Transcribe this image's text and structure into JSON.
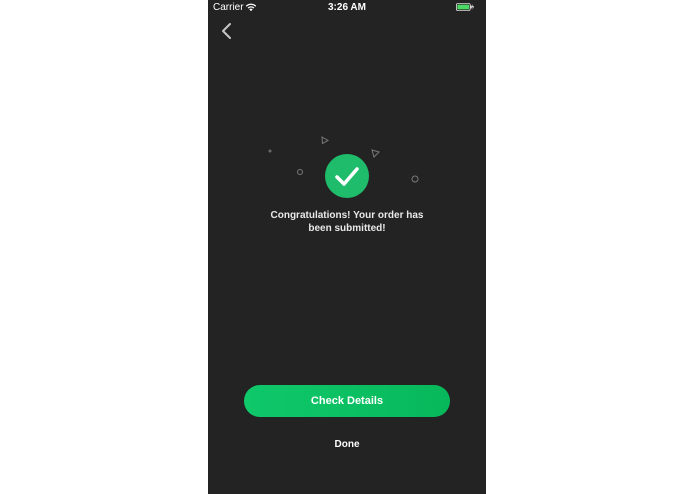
{
  "status_bar": {
    "carrier": "Carrier",
    "time": "3:26 AM",
    "wifi_icon": "wifi-icon",
    "battery_icon": "battery-icon",
    "charging_icon": "bolt-icon"
  },
  "nav": {
    "back_icon": "chevron-left-icon"
  },
  "success": {
    "icon": "checkmark-icon",
    "message_line1": "Congratulations! Your order has",
    "message_line2": "been submitted!"
  },
  "actions": {
    "primary_label": "Check Details",
    "secondary_label": "Done"
  },
  "colors": {
    "background": "#232323",
    "accent": "#1fbc6b",
    "text": "#ffffff",
    "battery": "#4cd964"
  }
}
